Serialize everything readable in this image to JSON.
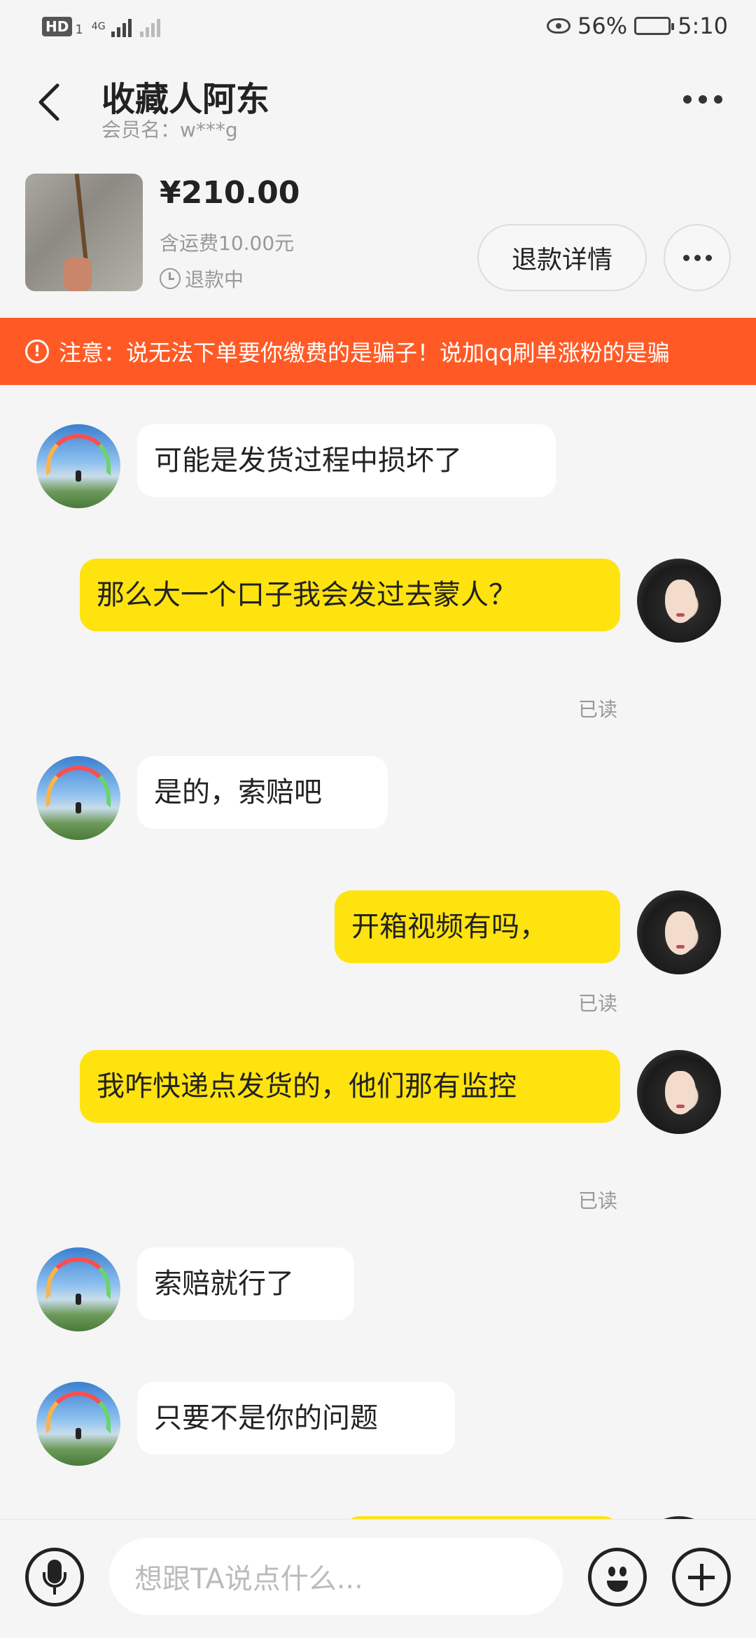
{
  "status_bar": {
    "hd_label": "HD",
    "hd_sub": "1",
    "network": "4G",
    "battery_percent": "56%",
    "battery_level": 0.56,
    "time": "5:10"
  },
  "header": {
    "title": "收藏人阿东",
    "member": "会员名：w***g"
  },
  "product": {
    "price": "¥210.00",
    "shipping": "含运费10.00元",
    "status": "退款中",
    "refund_button": "退款详情"
  },
  "warning": {
    "text": "注意：说无法下单要你缴费的是骗子！说加qq刷单涨粉的是骗"
  },
  "messages": [
    {
      "side": "in",
      "text": "可能是发货过程中损坏了"
    },
    {
      "side": "out",
      "text": "那么大一个口子我会发过去蒙人？",
      "status": "已读"
    },
    {
      "side": "in",
      "text": "是的，索赔吧"
    },
    {
      "side": "out",
      "text": "开箱视频有吗，",
      "status": "已读"
    },
    {
      "side": "out",
      "text": "我咋快递点发货的，他们那有监控",
      "status": "已读"
    },
    {
      "side": "in",
      "text": "索赔就行了"
    },
    {
      "side": "in",
      "text": "只要不是你的问题"
    }
  ],
  "input": {
    "placeholder": "想跟TA说点什么..."
  }
}
